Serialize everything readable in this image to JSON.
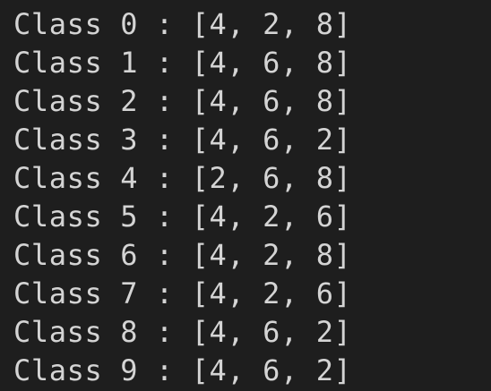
{
  "terminal": {
    "background": "#1e1e1e",
    "foreground": "#d4d4d4",
    "lines": [
      "Class 0 : [4, 2, 8]",
      "Class 1 : [4, 6, 8]",
      "Class 2 : [4, 6, 8]",
      "Class 3 : [4, 6, 2]",
      "Class 4 : [2, 6, 8]",
      "Class 5 : [4, 2, 6]",
      "Class 6 : [4, 2, 8]",
      "Class 7 : [4, 2, 6]",
      "Class 8 : [4, 6, 2]",
      "Class 9 : [4, 6, 2]"
    ]
  }
}
